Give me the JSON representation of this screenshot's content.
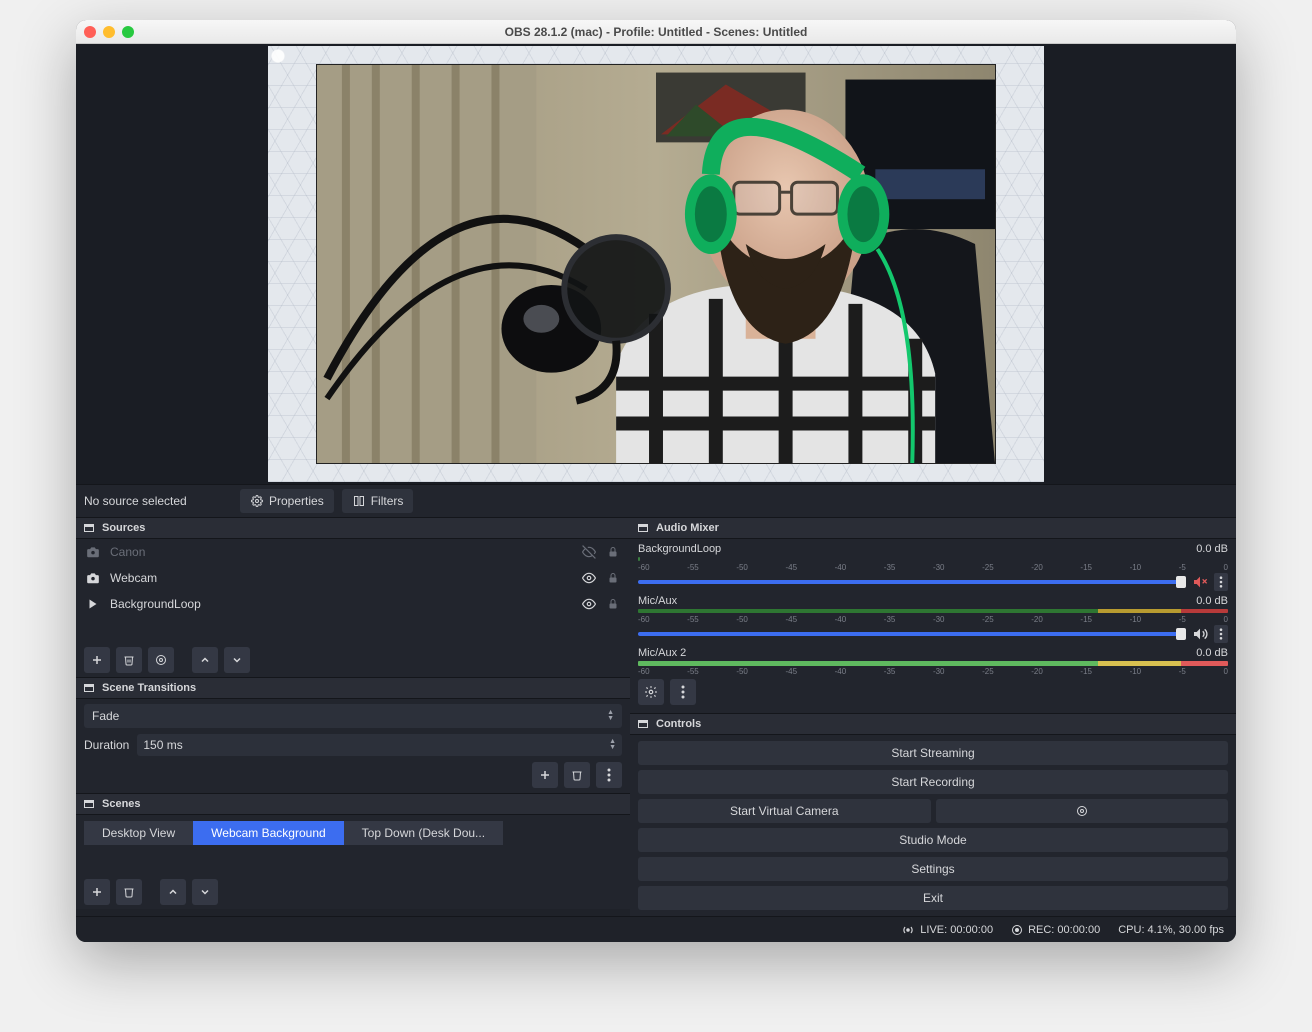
{
  "window": {
    "title": "OBS 28.1.2 (mac) - Profile: Untitled - Scenes: Untitled"
  },
  "source_info": {
    "status": "No source selected",
    "properties_label": "Properties",
    "filters_label": "Filters"
  },
  "sources": {
    "header": "Sources",
    "items": [
      {
        "name": "Canon",
        "icon": "camera-icon",
        "visible": false,
        "locked": true,
        "dim": true
      },
      {
        "name": "Webcam",
        "icon": "camera-icon",
        "visible": true,
        "locked": true,
        "dim": false
      },
      {
        "name": "BackgroundLoop",
        "icon": "play-icon",
        "visible": true,
        "locked": true,
        "dim": false
      }
    ]
  },
  "transitions": {
    "header": "Scene Transitions",
    "current": "Fade",
    "duration_label": "Duration",
    "duration_value": "150 ms"
  },
  "scenes": {
    "header": "Scenes",
    "items": [
      {
        "label": "Desktop View",
        "active": false
      },
      {
        "label": "Webcam Background",
        "active": true
      },
      {
        "label": "Top Down (Desk Dou...",
        "active": false
      }
    ]
  },
  "audio": {
    "header": "Audio Mixer",
    "scale": [
      "-60",
      "-55",
      "-50",
      "-45",
      "-40",
      "-35",
      "-30",
      "-25",
      "-20",
      "-15",
      "-10",
      "-5",
      "0"
    ],
    "tracks": [
      {
        "name": "BackgroundLoop",
        "db": "0.0 dB",
        "muted": true,
        "type": "bg"
      },
      {
        "name": "Mic/Aux",
        "db": "0.0 dB",
        "muted": false,
        "type": "mic"
      },
      {
        "name": "Mic/Aux 2",
        "db": "0.0 dB",
        "muted": false,
        "type": "mic2"
      }
    ]
  },
  "controls": {
    "header": "Controls",
    "start_streaming": "Start Streaming",
    "start_recording": "Start Recording",
    "start_virtual_cam": "Start Virtual Camera",
    "studio_mode": "Studio Mode",
    "settings": "Settings",
    "exit": "Exit"
  },
  "status": {
    "live": "LIVE: 00:00:00",
    "rec": "REC: 00:00:00",
    "cpu": "CPU: 4.1%, 30.00 fps"
  }
}
